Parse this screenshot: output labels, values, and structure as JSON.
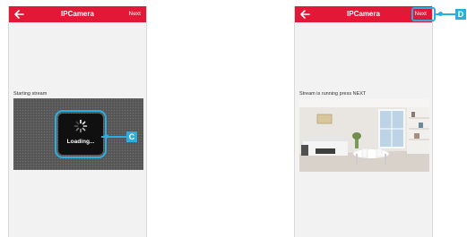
{
  "left_screen": {
    "title": "IPCamera",
    "next_label": "Next",
    "status": "Starting stream",
    "loading_label": "Loading...",
    "callout": "C"
  },
  "right_screen": {
    "title": "IPCamera",
    "next_label": "Next",
    "status": "Stream is running press NEXT",
    "callout": "D"
  },
  "colors": {
    "header": "#e31837",
    "callout": "#29aee0"
  }
}
